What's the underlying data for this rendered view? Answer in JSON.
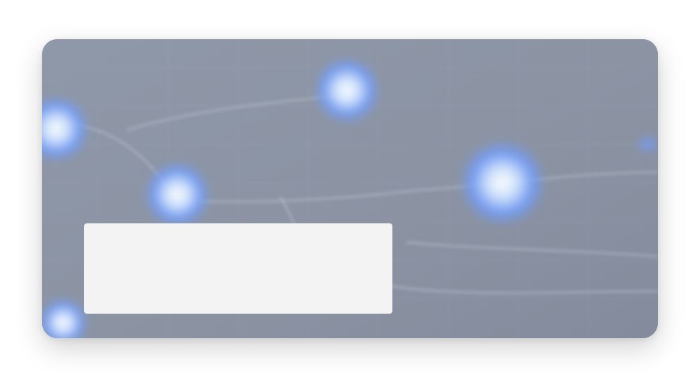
{
  "banner": {
    "background_description_icon": "network-nodes-illustration",
    "accent_color": "#6f9cff",
    "base_color": "#8a93a3",
    "panel_color": "#f3f3f3",
    "panel_text": ""
  }
}
